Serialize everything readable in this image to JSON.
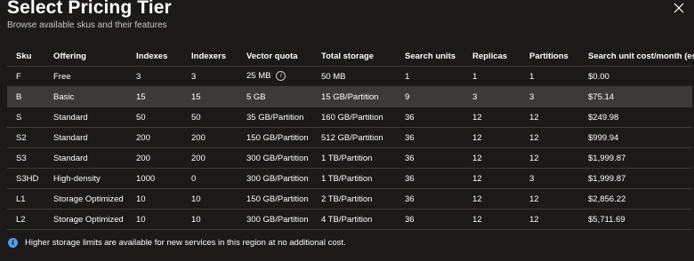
{
  "header": {
    "title": "Select Pricing Tier",
    "subtitle": "Browse available skus and their features"
  },
  "table": {
    "columns": [
      "Sku",
      "Offering",
      "Indexes",
      "Indexers",
      "Vector quota",
      "Total storage",
      "Search units",
      "Replicas",
      "Partitions",
      "Search unit cost/month (est.)"
    ],
    "rows": [
      [
        "F",
        "Free",
        "3",
        "3",
        "25 MB",
        "50 MB",
        "1",
        "1",
        "1",
        "$0.00"
      ],
      [
        "B",
        "Basic",
        "15",
        "15",
        "5 GB",
        "15 GB/Partition",
        "9",
        "3",
        "3",
        "$75.14"
      ],
      [
        "S",
        "Standard",
        "50",
        "50",
        "35 GB/Partition",
        "160 GB/Partition",
        "36",
        "12",
        "12",
        "$249.98"
      ],
      [
        "S2",
        "Standard",
        "200",
        "200",
        "150 GB/Partition",
        "512 GB/Partition",
        "36",
        "12",
        "12",
        "$999.94"
      ],
      [
        "S3",
        "Standard",
        "200",
        "200",
        "300 GB/Partition",
        "1 TB/Partition",
        "36",
        "12",
        "12",
        "$1,999.87"
      ],
      [
        "S3HD",
        "High-density",
        "1000",
        "0",
        "300 GB/Partition",
        "1 TB/Partition",
        "36",
        "12",
        "3",
        "$1,999.87"
      ],
      [
        "L1",
        "Storage Optimized",
        "10",
        "10",
        "150 GB/Partition",
        "2 TB/Partition",
        "36",
        "12",
        "12",
        "$2,856.22"
      ],
      [
        "L2",
        "Storage Optimized",
        "10",
        "10",
        "300 GB/Partition",
        "4 TB/Partition",
        "36",
        "12",
        "12",
        "$5,711.69"
      ]
    ],
    "selected_row": 1
  },
  "footer": {
    "info_icon": "info-icon",
    "text": "Higher storage limits are available for new services in this region at no additional cost."
  },
  "colors": {
    "background": "#1b1a19",
    "selected_row": "#3b3a39",
    "info_blue": "#4f9de8"
  }
}
